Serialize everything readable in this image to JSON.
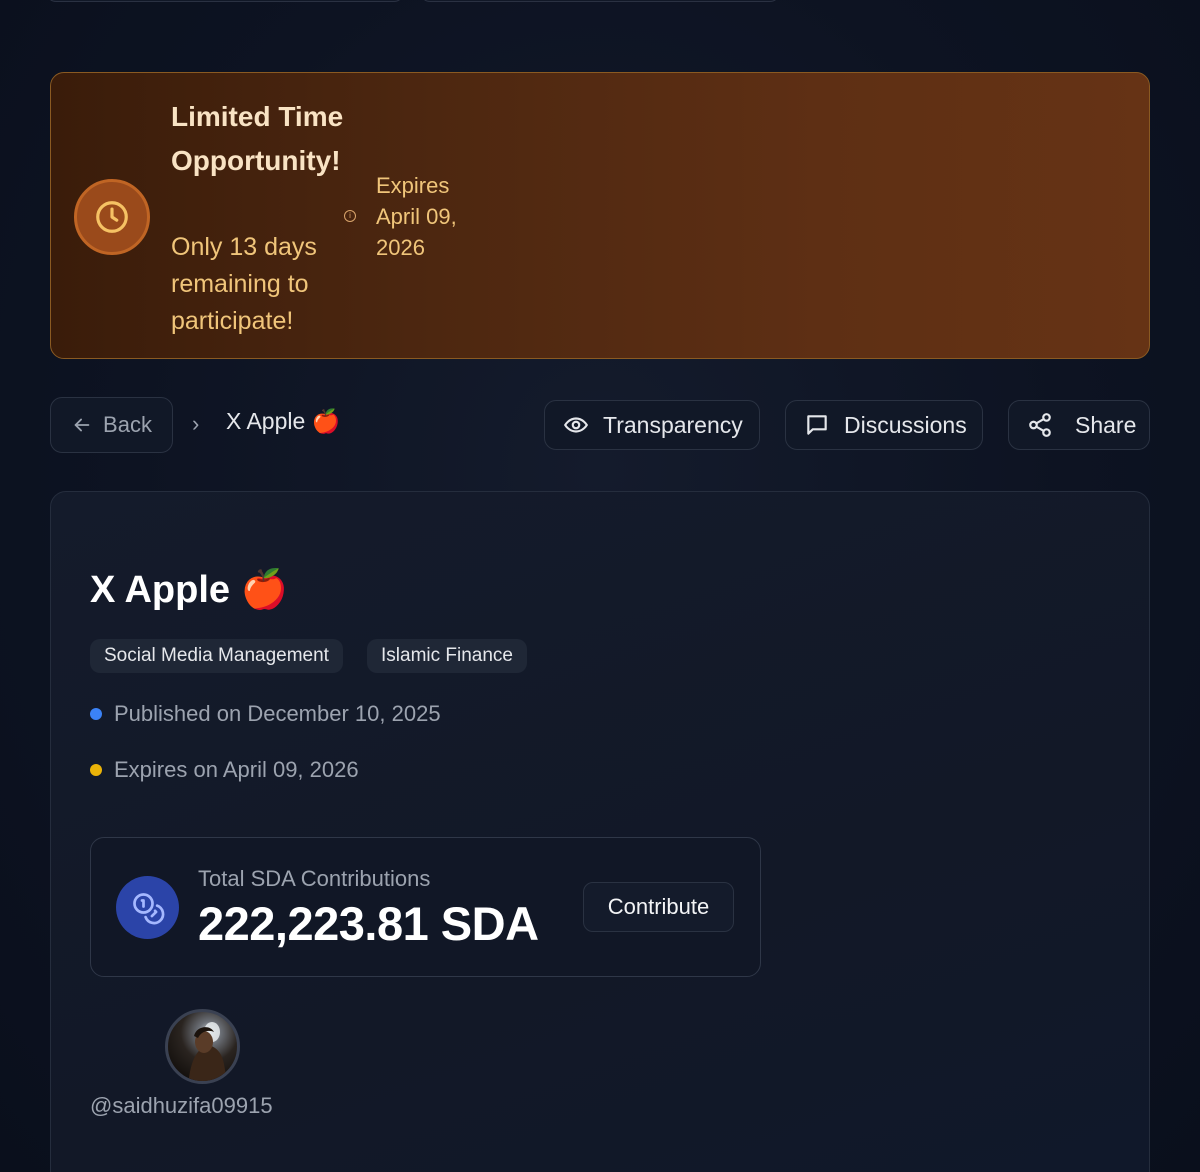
{
  "banner": {
    "title": "Limited Time Opportunity!",
    "subtitle": "Only 13 days remaining to participate!",
    "expires": "Expires April 09, 2026",
    "info_glyph": "i",
    "clock_icon": "clock-icon"
  },
  "nav": {
    "back_label": "Back",
    "separator": "›",
    "breadcrumb_title": "X Apple 🍎",
    "transparency_label": "Transparency",
    "discussions_label": "Discussions",
    "share_label": "Share"
  },
  "project": {
    "title": "X Apple 🍎",
    "tags": [
      "Social Media Management",
      "Islamic Finance"
    ],
    "published": "Published on December 10, 2025",
    "expires": "Expires on April 09, 2026",
    "published_dot_color": "#3b82f6",
    "expires_dot_color": "#eab308"
  },
  "contributions": {
    "label": "Total SDA Contributions",
    "amount": "222,223.81 SDA",
    "button_label": "Contribute",
    "icon": "coins-icon"
  },
  "owner": {
    "username": "@saidhuzifa09915"
  },
  "colors": {
    "background": "#0b1120",
    "banner_accent": "#f0c57a",
    "card": "#131a29"
  }
}
